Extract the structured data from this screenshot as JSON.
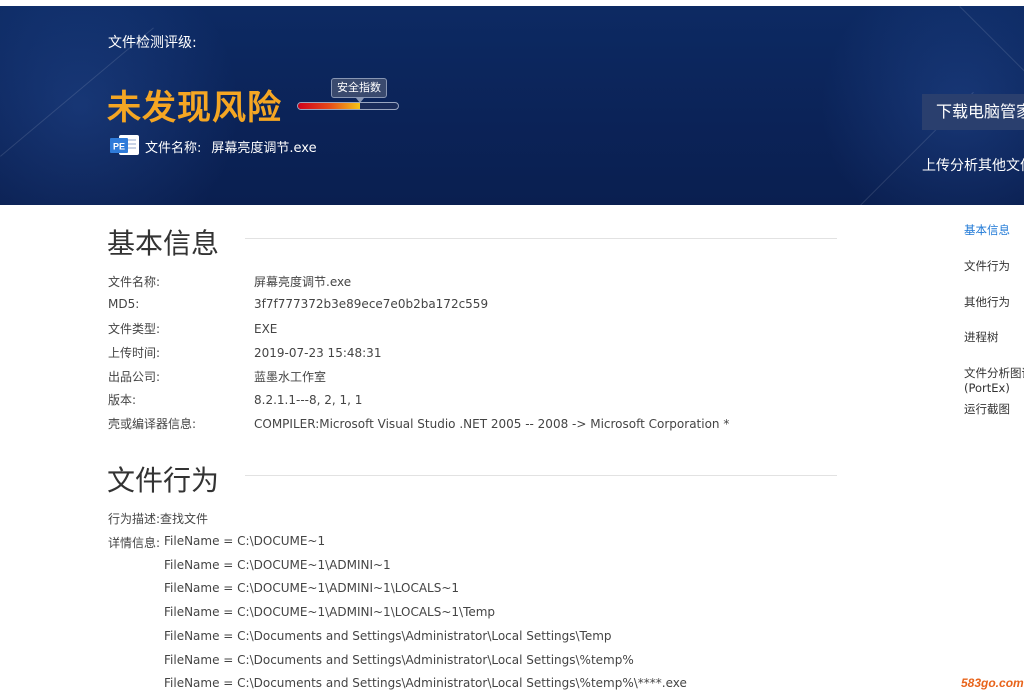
{
  "header": {
    "level_label": "文件检测评级:",
    "risk_title": "未发现风险",
    "safety_badge": "安全指数",
    "safety_level": 0.62,
    "file_icon_text": "PE",
    "file_name_label": "文件名称:",
    "file_name": "屏幕亮度调节.exe",
    "download_button": "下载电脑管家",
    "upload_link": "上传分析其他文件"
  },
  "basic_info": {
    "title": "基本信息",
    "rows": [
      {
        "key": "文件名称:",
        "value": "屏幕亮度调节.exe"
      },
      {
        "key": "MD5:",
        "value": "3f7f777372b3e89ece7e0b2ba172c559"
      },
      {
        "key": "文件类型:",
        "value": "EXE"
      },
      {
        "key": "上传时间:",
        "value": "2019-07-23 15:48:31"
      },
      {
        "key": "出品公司:",
        "value": "蓝墨水工作室"
      },
      {
        "key": "版本:",
        "value": "8.2.1.1---8, 2, 1, 1"
      },
      {
        "key": "壳或编译器信息:",
        "value": "COMPILER:Microsoft Visual Studio .NET 2005 -- 2008 -> Microsoft Corporation *"
      }
    ]
  },
  "file_behavior": {
    "title": "文件行为",
    "desc_label": "行为描述:",
    "desc_value": "查找文件",
    "detail_label": "详情信息:",
    "details": [
      "FileName = C:\\DOCUME~1",
      "FileName = C:\\DOCUME~1\\ADMINI~1",
      "FileName = C:\\DOCUME~1\\ADMINI~1\\LOCALS~1",
      "FileName = C:\\DOCUME~1\\ADMINI~1\\LOCALS~1\\Temp",
      "FileName = C:\\Documents and Settings\\Administrator\\Local Settings\\Temp",
      "FileName = C:\\Documents and Settings\\Administrator\\Local Settings\\%temp%",
      "FileName = C:\\Documents and Settings\\Administrator\\Local Settings\\%temp%\\****.exe"
    ]
  },
  "right_nav": {
    "items": [
      "基本信息",
      "文件行为",
      "其他行为",
      "进程树",
      "文件分析图谱",
      "(PortEx)",
      "运行截图"
    ]
  },
  "watermark": "583go.com",
  "colors": {
    "banner": "#0b2358",
    "risk_title": "#f5a623",
    "nav_active": "#1e78d6",
    "watermark": "#e8641b"
  }
}
